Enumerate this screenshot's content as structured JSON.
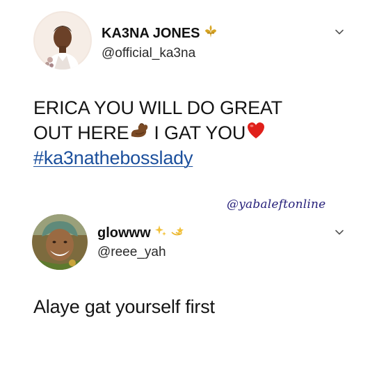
{
  "tweets": [
    {
      "display_name": "KA3NA JONES",
      "handle": "@official_ka3na",
      "name_icon": "fleur-de-lis-icon",
      "text_line1": "ERICA YOU WILL DO GREAT",
      "text_line2_a": "OUT HERE",
      "text_line2_b": "I GAT YOU",
      "hashtag": "#ka3natheb​osslady",
      "emojis": [
        "flexed-biceps-icon",
        "red-heart-icon"
      ]
    },
    {
      "display_name": "glowww",
      "handle": "@reee_yah",
      "name_icons": [
        "sparkles-icon",
        "dizzy-icon"
      ],
      "text": "Alaye gat yourself first"
    }
  ],
  "watermark": "@yabaleftonline",
  "colors": {
    "hashtag": "#1b4f9c",
    "watermark": "#26207a",
    "heart": "#e0201b"
  }
}
